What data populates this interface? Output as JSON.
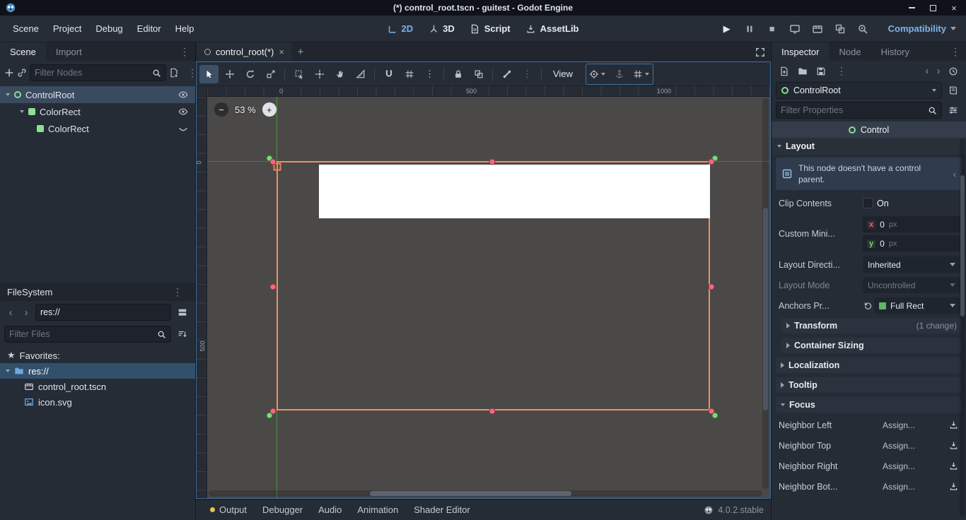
{
  "icons": {
    "dots": "⋮",
    "close": "×",
    "plus": "+",
    "minus": "−",
    "star": "★",
    "play": "▶",
    "stop": "■",
    "chevron_left": "‹",
    "chevron_right": "›"
  },
  "colors": {
    "accent_blue": "#7db3e8",
    "selection_blue": "#33506b",
    "control_orange": "#ef8e66",
    "anchor_pink": "#f06b7e",
    "anchor_green": "#7bdc79",
    "canvas_gray": "#4b4947"
  },
  "titlebar": {
    "title": "(*) control_root.tscn - guitest - Godot Engine"
  },
  "menubar": {
    "menus": [
      "Scene",
      "Project",
      "Debug",
      "Editor",
      "Help"
    ],
    "workspaces": [
      "2D",
      "3D",
      "Script",
      "AssetLib"
    ],
    "renderer": "Compatibility"
  },
  "scene_dock": {
    "tabs": [
      "Scene",
      "Import"
    ],
    "filter_placeholder": "Filter Nodes",
    "tree": [
      {
        "label": "ControlRoot"
      },
      {
        "label": "ColorRect"
      },
      {
        "label": "ColorRect"
      }
    ]
  },
  "filesystem": {
    "title": "FileSystem",
    "path": "res://",
    "filter_placeholder": "Filter Files",
    "favorites_label": "Favorites:",
    "root_label": "res://",
    "files": [
      "control_root.tscn",
      "icon.svg"
    ]
  },
  "canvas": {
    "tab_label": "control_root(*)",
    "view_label": "View",
    "zoom_label": "53 %",
    "ruler_top": [
      "0",
      "500",
      "1000"
    ],
    "ruler_left": [
      "0",
      "500"
    ]
  },
  "inspector": {
    "tabs": [
      "Inspector",
      "Node",
      "History"
    ],
    "node_name": "ControlRoot",
    "filter_placeholder": "Filter Properties",
    "class_name": "Control",
    "layout": {
      "header": "Layout",
      "warning": "This node doesn't have a control parent.",
      "clip_contents_label": "Clip Contents",
      "clip_contents_value": "On",
      "custom_min_label": "Custom Mini...",
      "x_label": "x",
      "x_value": "0",
      "x_unit": "px",
      "y_label": "y",
      "y_value": "0",
      "y_unit": "px",
      "layout_direction_label": "Layout Directi...",
      "layout_direction_value": "Inherited",
      "layout_mode_label": "Layout Mode",
      "layout_mode_value": "Uncontrolled",
      "anchors_label": "Anchors Pr...",
      "anchors_value": "Full Rect"
    },
    "sections": {
      "transform": "Transform",
      "transform_badge": "(1 change)",
      "container_sizing": "Container Sizing",
      "localization": "Localization",
      "tooltip": "Tooltip",
      "focus": "Focus"
    },
    "neighbors": [
      {
        "label": "Neighbor Left",
        "value": "Assign..."
      },
      {
        "label": "Neighbor Top",
        "value": "Assign..."
      },
      {
        "label": "Neighbor Right",
        "value": "Assign..."
      },
      {
        "label": "Neighbor Bot...",
        "value": "Assign..."
      }
    ]
  },
  "bottombar": {
    "tabs": [
      "Output",
      "Debugger",
      "Audio",
      "Animation",
      "Shader Editor"
    ],
    "version": "4.0.2.stable"
  }
}
